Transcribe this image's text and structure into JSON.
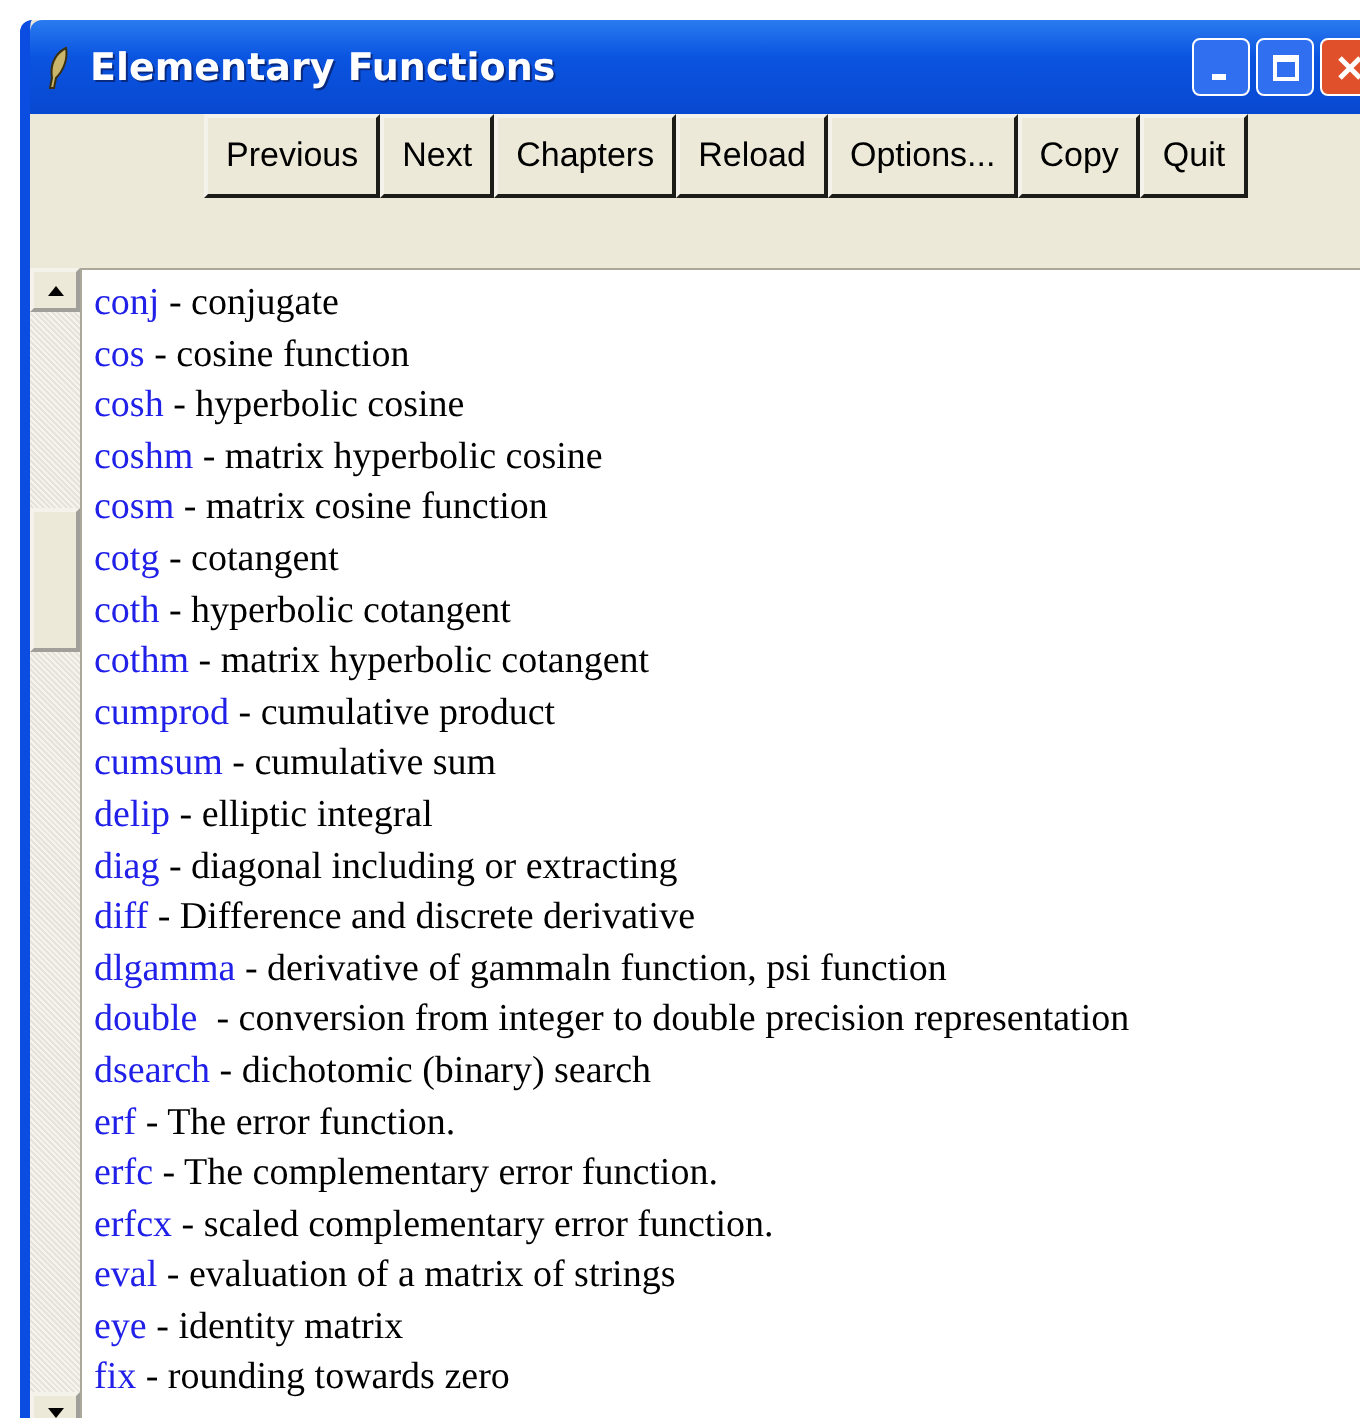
{
  "window": {
    "title": "Elementary Functions"
  },
  "toolbar": [
    "Previous",
    "Next",
    "Chapters",
    "Reload",
    "Options...",
    "Copy",
    "Quit"
  ],
  "entries": [
    {
      "name": "conj",
      "description": " - conjugate"
    },
    {
      "name": "cos",
      "description": " - cosine function"
    },
    {
      "name": "cosh",
      "description": " - hyperbolic cosine"
    },
    {
      "name": "coshm",
      "description": " - matrix hyperbolic cosine"
    },
    {
      "name": "cosm",
      "description": " - matrix cosine function"
    },
    {
      "name": "cotg",
      "description": " - cotangent"
    },
    {
      "name": "coth",
      "description": " - hyperbolic cotangent"
    },
    {
      "name": "cothm",
      "description": " - matrix hyperbolic cotangent"
    },
    {
      "name": "cumprod",
      "description": " - cumulative product"
    },
    {
      "name": "cumsum",
      "description": " - cumulative sum"
    },
    {
      "name": "delip",
      "description": " - elliptic integral"
    },
    {
      "name": "diag",
      "description": " - diagonal including or extracting"
    },
    {
      "name": "diff",
      "description": " - Difference and discrete derivative"
    },
    {
      "name": "dlgamma",
      "description": " - derivative of gammaln function, psi function"
    },
    {
      "name": "double",
      "description": "  - conversion from integer to double precision representation"
    },
    {
      "name": "dsearch",
      "description": " - dichotomic (binary) search"
    },
    {
      "name": "erf",
      "description": " - The error function."
    },
    {
      "name": "erfc",
      "description": " - The complementary error function."
    },
    {
      "name": "erfcx",
      "description": " - scaled complementary error function."
    },
    {
      "name": "eval",
      "description": " - evaluation of a matrix of strings"
    },
    {
      "name": "eye",
      "description": " - identity matrix"
    },
    {
      "name": "fix",
      "description": " - rounding towards zero"
    }
  ]
}
